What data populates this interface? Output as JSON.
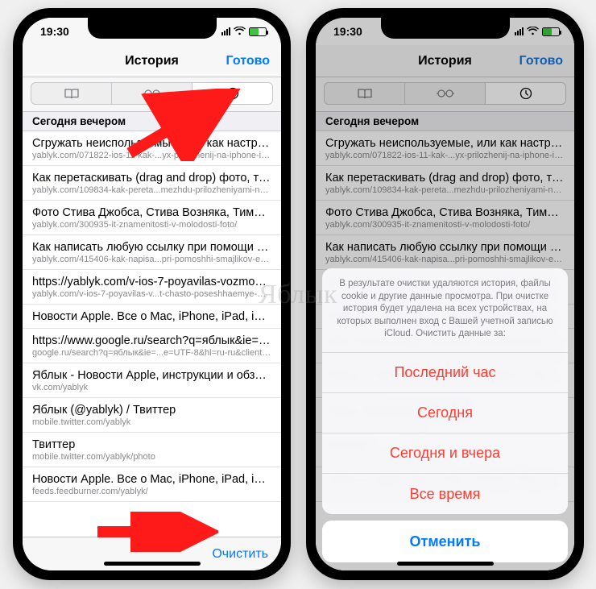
{
  "status": {
    "time": "19:30"
  },
  "navbar": {
    "title": "История",
    "done": "Готово"
  },
  "section_header": "Сегодня вечером",
  "toolbar": {
    "clear": "Очистить"
  },
  "watermark": "Яблык",
  "history": [
    {
      "title": "Сгружать неиспользуемые, или как настрои..",
      "url": "yablyk.com/071822-ios-11-kak-...yx-prilozhenij-na-iphone-i-ipad/"
    },
    {
      "title": "Как перетаскивать (drag and drop) фото, тек..",
      "url": "yablyk.com/109834-kak-pereta...mezhdu-prilozheniyami-na-ipad/"
    },
    {
      "title": "Фото Стива Джобса, Стива Возняка, Тима Ку..",
      "url": "yablyk.com/300935-it-znamenitosti-v-molodosti-foto/"
    },
    {
      "title": "Как написать любую ссылку при помощи см..",
      "url": "yablyk.com/415406-kak-napisa...pri-pomoshhi-smajlikov-emodzi/"
    },
    {
      "title": "https://yablyk.com/v-ios-7-poyavilas-vozmozh..",
      "url": "yablyk.com/v-ios-7-poyavilas-v...t-chasto-poseshhaemye-mesta/"
    },
    {
      "title": "Новости Apple. Все о Mac, iPhone, iPad, iOS,..",
      "url": ""
    },
    {
      "title": "https://www.google.ru/search?q=яблык&ie=U..",
      "url": "google.ru/search?q=яблык&ie=...e=UTF-8&hl=ru-ru&client=safari"
    },
    {
      "title": "Яблык - Новости Apple, инструкции и обзор..",
      "url": "vk.com/yablyk"
    },
    {
      "title": "Яблык (@yablyk) / Твиттер",
      "url": "mobile.twitter.com/yablyk"
    },
    {
      "title": "Твиттер",
      "url": "mobile.twitter.com/yablyk/photo"
    },
    {
      "title": "Новости Apple. Все о Mac, iPhone, iPad, iOS,..",
      "url": "feeds.feedburner.com/yablyk/"
    }
  ],
  "right_history_visible": 5,
  "sheet": {
    "message": "В результате очистки удаляются история, файлы cookie и другие данные просмотра. При очистке история будет удалена на всех устройствах, на которых выполнен вход с Вашей учетной записью iCloud. Очистить данные за:",
    "options": [
      "Последний час",
      "Сегодня",
      "Сегодня и вчера",
      "Все время"
    ],
    "cancel": "Отменить"
  },
  "tabs": {
    "bookmarks": "bookmarks",
    "reading": "reading-list",
    "history": "history"
  },
  "colors": {
    "accent": "#007aff",
    "destructive": "#ff3b30"
  }
}
